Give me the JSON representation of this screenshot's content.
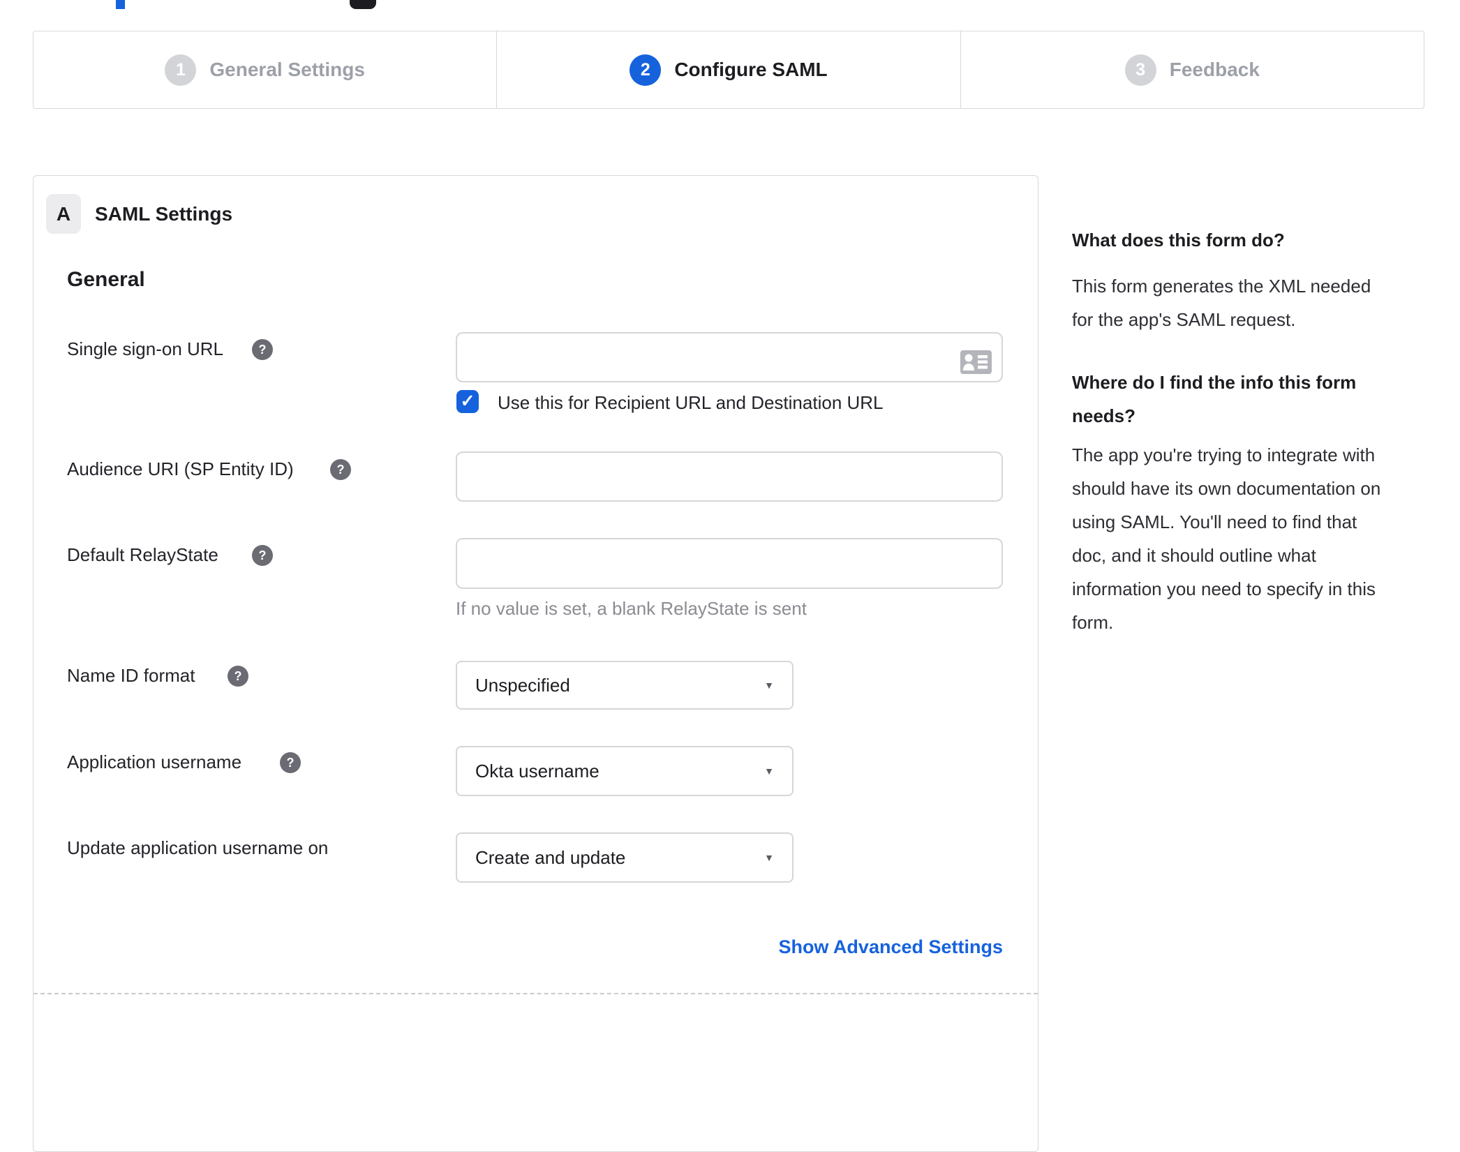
{
  "colors": {
    "accent_blue": "#1662dd",
    "inactive_gray": "#d3d4d8",
    "border_gray": "#d8d8dc"
  },
  "icons": {
    "help": "?",
    "check": "✓",
    "caret_down": "▼",
    "contact_card": "contact-card"
  },
  "stepper": {
    "steps": [
      {
        "number": "1",
        "label": "General Settings",
        "state": "inactive"
      },
      {
        "number": "2",
        "label": "Configure SAML",
        "state": "active"
      },
      {
        "number": "3",
        "label": "Feedback",
        "state": "inactive"
      }
    ]
  },
  "panel": {
    "badge": "A",
    "title": "SAML Settings",
    "section_heading": "General",
    "fields": {
      "sso": {
        "label": "Single sign-on URL",
        "value": "",
        "checkbox_checked": true,
        "checkbox_label": "Use this for Recipient URL and Destination URL"
      },
      "audience": {
        "label": "Audience URI (SP Entity ID)",
        "value": ""
      },
      "relay": {
        "label": "Default RelayState",
        "value": "",
        "hint": "If no value is set, a blank RelayState is sent"
      },
      "nameid": {
        "label": "Name ID format",
        "value": "Unspecified"
      },
      "appuser": {
        "label": "Application username",
        "value": "Okta username"
      },
      "updateuser": {
        "label": "Update application username on",
        "value": "Create and update"
      }
    },
    "advanced_link": "Show Advanced Settings"
  },
  "sidebar": {
    "heading1": "What does this form do?",
    "paragraph1": [
      "This form generates the XML needed",
      "for the app's SAML request."
    ],
    "heading2": [
      "Where do I find the info this form",
      "needs?"
    ],
    "paragraph2": [
      "The app you're trying to integrate with",
      "should have its own documentation on",
      "using SAML. You'll need to find that",
      "doc, and it should outline what",
      "information you need to specify in this",
      "form."
    ]
  }
}
